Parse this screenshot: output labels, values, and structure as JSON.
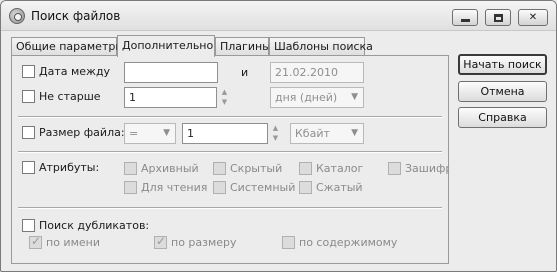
{
  "window": {
    "title": "Поиск файлов"
  },
  "tabs": [
    {
      "label": "Общие параметры"
    },
    {
      "label": "Дополнительно"
    },
    {
      "label": "Плагины"
    },
    {
      "label": "Шаблоны поиска"
    }
  ],
  "date": {
    "label": "Дата между",
    "and_label": "и",
    "from_value": "",
    "to_value": "21.02.2010"
  },
  "not_older": {
    "label": "Не старше",
    "value": "1",
    "unit": "дня (дней)"
  },
  "file_size": {
    "label": "Размер файла:",
    "operator": "=",
    "value": "1",
    "unit": "Кбайт"
  },
  "attributes": {
    "label": "Атрибуты:",
    "items": [
      {
        "label": "Архивный"
      },
      {
        "label": "Скрытый"
      },
      {
        "label": "Каталог"
      },
      {
        "label": "Зашифро"
      },
      {
        "label": "Для чтения"
      },
      {
        "label": "Системный"
      },
      {
        "label": "Сжатый"
      }
    ]
  },
  "duplicates": {
    "label": "Поиск дубликатов:",
    "by_name": "по имени",
    "by_size": "по размеру",
    "by_content": "по содержимому"
  },
  "buttons": {
    "start": "Начать поиск",
    "cancel": "Отмена",
    "help": "Справка"
  }
}
